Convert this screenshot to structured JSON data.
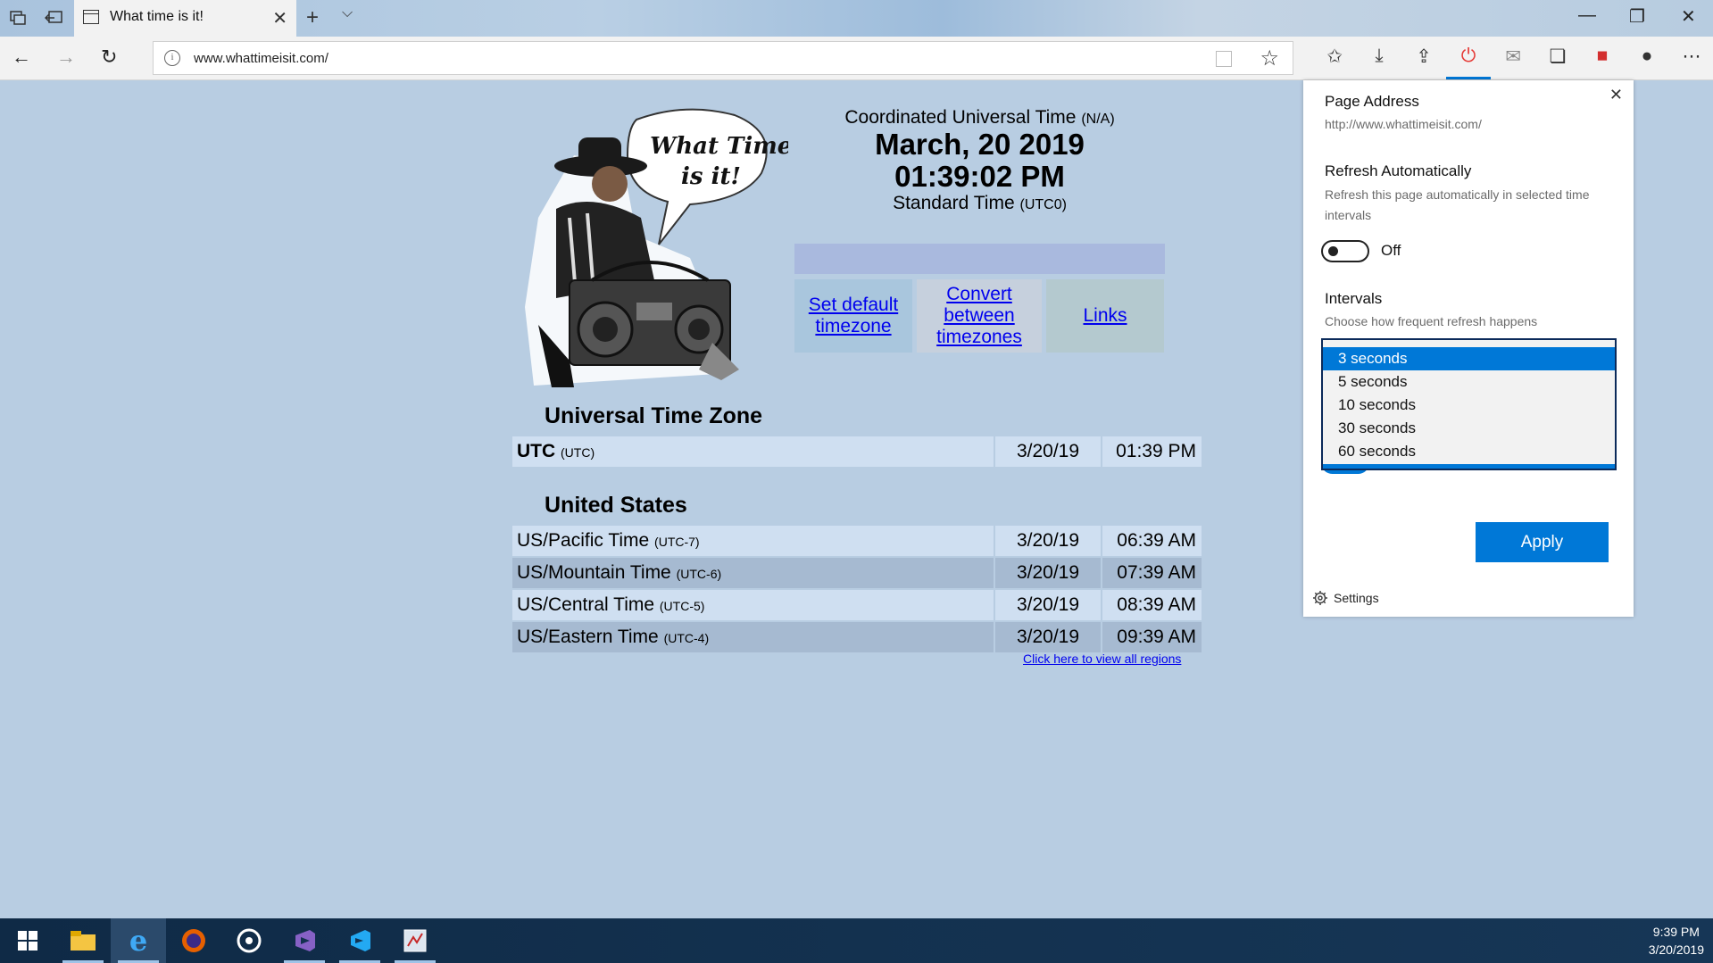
{
  "browser": {
    "tab_title": "What time is it!",
    "new_tab_glyph": "+",
    "url": "www.whattimeisit.com/",
    "toolbar_icons": [
      "hub-icon",
      "download-icon",
      "share-icon",
      "auto-refresh-icon",
      "mail-icon",
      "pages-icon",
      "pdf-icon",
      "ninja-icon",
      "more-icon"
    ]
  },
  "page": {
    "mascot_caption_line1": "What Time",
    "mascot_caption_line2": "is it!",
    "zone_name": "Coordinated Universal Time",
    "zone_note": "(N/A)",
    "date": "March, 20 2019",
    "time": "01:39:02 PM",
    "standard_label": "Standard Time",
    "standard_offset": "(UTC0)",
    "links": {
      "set_default": "Set default timezone",
      "convert": "Convert between timezones",
      "links": "Links"
    },
    "universal_section": "Universal Time Zone",
    "utc_row": {
      "name": "UTC",
      "offset": "(UTC)",
      "date": "3/20/19",
      "time": "01:39 PM"
    },
    "us_section": "United States",
    "us_rows": [
      {
        "name": "US/Pacific Time",
        "offset": "(UTC-7)",
        "date": "3/20/19",
        "time": "06:39 AM"
      },
      {
        "name": "US/Mountain Time",
        "offset": "(UTC-6)",
        "date": "3/20/19",
        "time": "07:39 AM"
      },
      {
        "name": "US/Central Time",
        "offset": "(UTC-5)",
        "date": "3/20/19",
        "time": "08:39 AM"
      },
      {
        "name": "US/Eastern Time",
        "offset": "(UTC-4)",
        "date": "3/20/19",
        "time": "09:39 AM"
      }
    ],
    "view_all": "Click here to view all regions"
  },
  "panel": {
    "page_address_label": "Page Address",
    "page_address_value": "http://www.whattimeisit.com/",
    "refresh_label": "Refresh Automatically",
    "refresh_desc": "Refresh this page automatically in selected time intervals",
    "refresh_state": "Off",
    "intervals_label": "Intervals",
    "intervals_desc": "Choose how frequent refresh happens",
    "interval_options": [
      "3 seconds",
      "5 seconds",
      "10 seconds",
      "30 seconds",
      "60 seconds"
    ],
    "selected_interval": "3 seconds",
    "hidden_toggle_state": "On",
    "apply_label": "Apply",
    "settings_label": "Settings"
  },
  "taskbar": {
    "time": "9:39 PM",
    "date": "3/20/2019",
    "apps": [
      "windows-start-icon",
      "file-explorer-icon",
      "edge-icon",
      "firefox-icon",
      "media-icon",
      "visual-studio-icon",
      "vscode-icon",
      "app-icon"
    ]
  },
  "colors": {
    "accent": "#0078d7",
    "page_bg": "#b8cde2",
    "row_light": "#cfdff1",
    "row_dark": "#a6bad1",
    "link": "#0000ee"
  }
}
